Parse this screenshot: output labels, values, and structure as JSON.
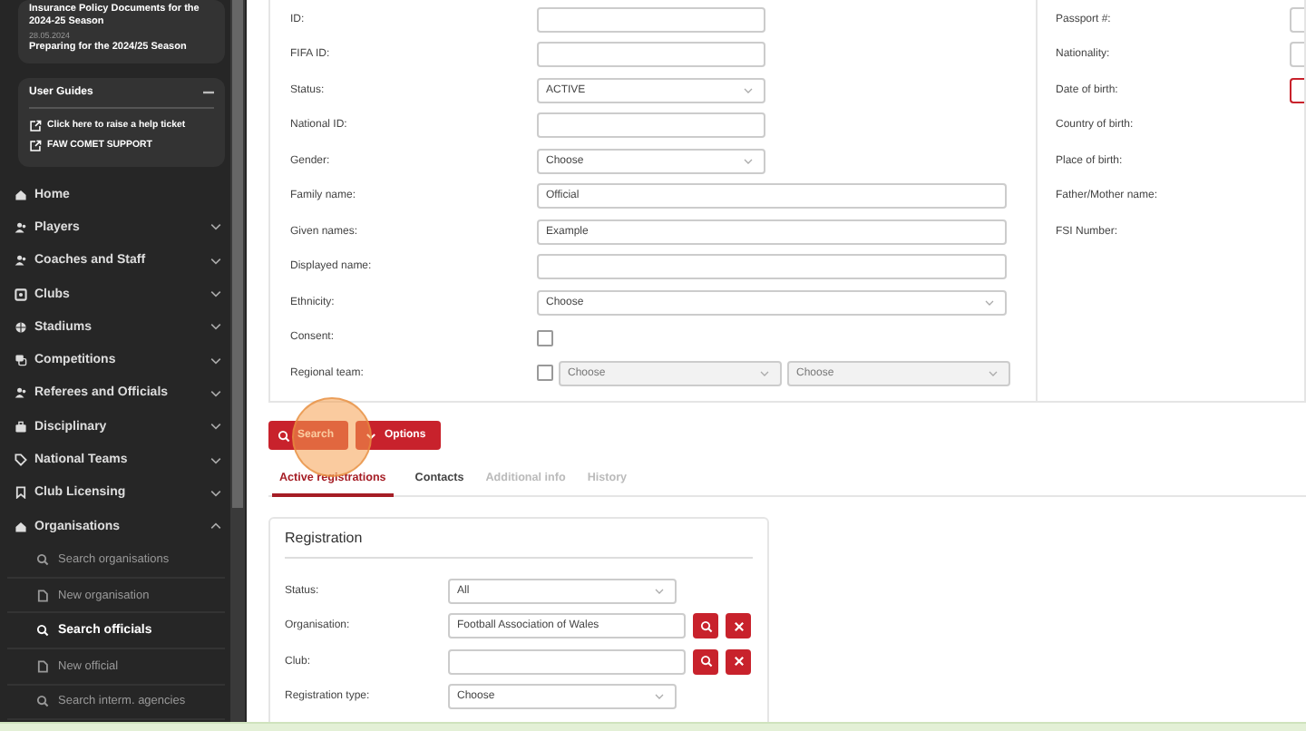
{
  "sidebar": {
    "news": {
      "title": "Insurance Policy Documents for the 2024-25 Season",
      "date": "28.05.2024",
      "subtitle": "Preparing for the 2024/25 Season"
    },
    "user_guides": {
      "title": "User Guides",
      "expanded": true,
      "links": [
        "Click here to raise a help ticket",
        "FAW COMET SUPPORT"
      ]
    },
    "nav": [
      {
        "label": "Home",
        "kind": "home"
      },
      {
        "label": "Players",
        "kind": "people",
        "expanded": false
      },
      {
        "label": "Coaches and Staff",
        "kind": "people",
        "expanded": false
      },
      {
        "label": "Clubs",
        "kind": "shield",
        "expanded": false
      },
      {
        "label": "Stadiums",
        "kind": "globe",
        "expanded": false
      },
      {
        "label": "Competitions",
        "kind": "cup",
        "expanded": false
      },
      {
        "label": "Referees and Officials",
        "kind": "people",
        "expanded": false
      },
      {
        "label": "Disciplinary",
        "kind": "briefcase",
        "expanded": false
      },
      {
        "label": "National Teams",
        "kind": "tag",
        "expanded": false
      },
      {
        "label": "Club Licensing",
        "kind": "bookmark",
        "expanded": false
      },
      {
        "label": "Organisations",
        "kind": "home",
        "expanded": true,
        "children": [
          {
            "label": "Search organisations",
            "kind": "search",
            "selected": false
          },
          {
            "label": "New organisation",
            "kind": "file",
            "selected": false
          },
          {
            "label": "Search officials",
            "kind": "search",
            "selected": true
          },
          {
            "label": "New official",
            "kind": "file",
            "selected": false
          },
          {
            "label": "Search interm. agencies",
            "kind": "search",
            "selected": false
          }
        ]
      }
    ]
  },
  "form": {
    "left": [
      {
        "label": "ID:",
        "kind": "text"
      },
      {
        "label": "FIFA ID:",
        "kind": "text"
      },
      {
        "label": "Status:",
        "kind": "select",
        "value": "ACTIVE"
      },
      {
        "label": "National ID:",
        "kind": "text"
      },
      {
        "label": "Gender:",
        "kind": "select",
        "placeholder": "Choose"
      },
      {
        "label": "Family name:",
        "kind": "wide_text",
        "value": "Official"
      },
      {
        "label": "Given names:",
        "kind": "wide_text",
        "value": "Example"
      },
      {
        "label": "Displayed name:",
        "kind": "wide_text"
      },
      {
        "label": "Ethnicity:",
        "kind": "wide_select",
        "placeholder": "Choose"
      },
      {
        "label": "Consent:",
        "kind": "checkbox",
        "checked": false
      },
      {
        "label": "Regional team:",
        "kind": "regional",
        "checked": false,
        "selects": [
          "Choose",
          "Choose"
        ]
      }
    ],
    "right": [
      {
        "label": "Passport #:",
        "kind": "text"
      },
      {
        "label": "Nationality:",
        "kind": "text"
      },
      {
        "label": "Date of birth:",
        "kind": "focused"
      },
      {
        "label": "Country of birth:"
      },
      {
        "label": "Place of birth:"
      },
      {
        "label": "Father/Mother name:"
      },
      {
        "label": "FSI Number:"
      }
    ]
  },
  "buttons": [
    {
      "label": "Search",
      "kind": "search"
    },
    {
      "label": "Options",
      "kind": "caret"
    }
  ],
  "tabs": [
    {
      "label": "Active registrations",
      "selected": true,
      "disabled": false
    },
    {
      "label": "Contacts",
      "selected": false,
      "disabled": false
    },
    {
      "label": "Additional info",
      "selected": false,
      "disabled": true
    },
    {
      "label": "History",
      "selected": false,
      "disabled": true
    }
  ],
  "registration": {
    "title": "Registration",
    "fields": [
      {
        "label": "Status:",
        "kind": "select",
        "value": "All"
      },
      {
        "label": "Organisation:",
        "kind": "lookup",
        "value": "Football Association of Wales"
      },
      {
        "label": "Club:",
        "kind": "lookup"
      },
      {
        "label": "Registration type:",
        "kind": "select",
        "placeholder": "Choose"
      }
    ]
  }
}
